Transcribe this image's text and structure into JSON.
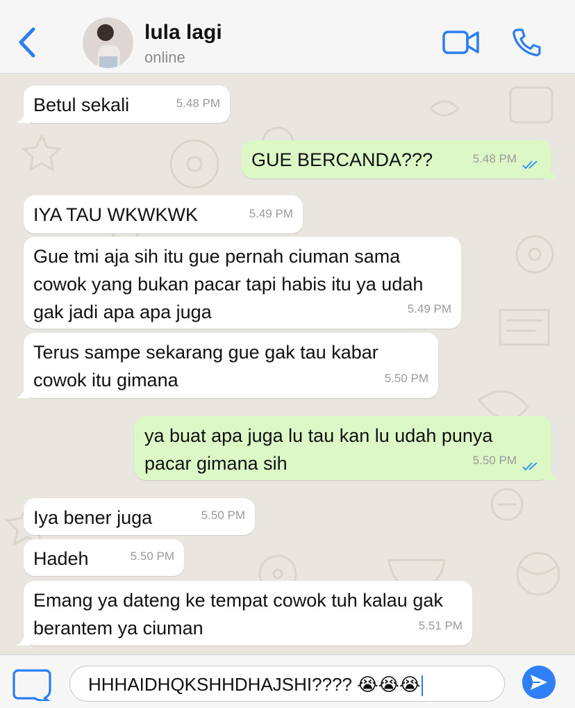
{
  "header": {
    "contact_name": "lula lagi",
    "status": "online",
    "accent_color": "#2a7ef0"
  },
  "messages": [
    {
      "direction": "in",
      "text": "Betul sekali",
      "time": "5.48 PM"
    },
    {
      "direction": "out",
      "text": "GUE BERCANDA???",
      "time": "5.48 PM",
      "read": true
    },
    {
      "direction": "in",
      "text": "IYA TAU WKWKWK",
      "time": "5.49 PM"
    },
    {
      "direction": "in",
      "text": "Gue tmi aja sih itu gue pernah ciuman sama cowok yang bukan pacar tapi habis itu ya udah gak jadi apa apa juga",
      "time": "5.49 PM"
    },
    {
      "direction": "in",
      "text": "Terus sampe sekarang gue gak tau kabar cowok itu gimana",
      "time": "5.50 PM"
    },
    {
      "direction": "out",
      "text": "ya buat apa juga lu tau kan lu udah punya pacar gimana sih",
      "time": "5.50 PM",
      "read": true
    },
    {
      "direction": "in",
      "text": "Iya bener juga",
      "time": "5.50 PM"
    },
    {
      "direction": "in",
      "text": "Hadeh",
      "time": "5.50 PM"
    },
    {
      "direction": "in",
      "text": "Emang ya dateng ke tempat cowok tuh kalau gak berantem ya ciuman",
      "time": "5.51 PM"
    }
  ],
  "composer": {
    "value": "HHHAIDHQKSHHDHAJSHI???? 😭😭😭"
  },
  "colors": {
    "incoming_bubble": "#ffffff",
    "outgoing_bubble": "#dcf8c6",
    "chat_background": "#e9e5df",
    "send_button": "#2f7ff6"
  }
}
